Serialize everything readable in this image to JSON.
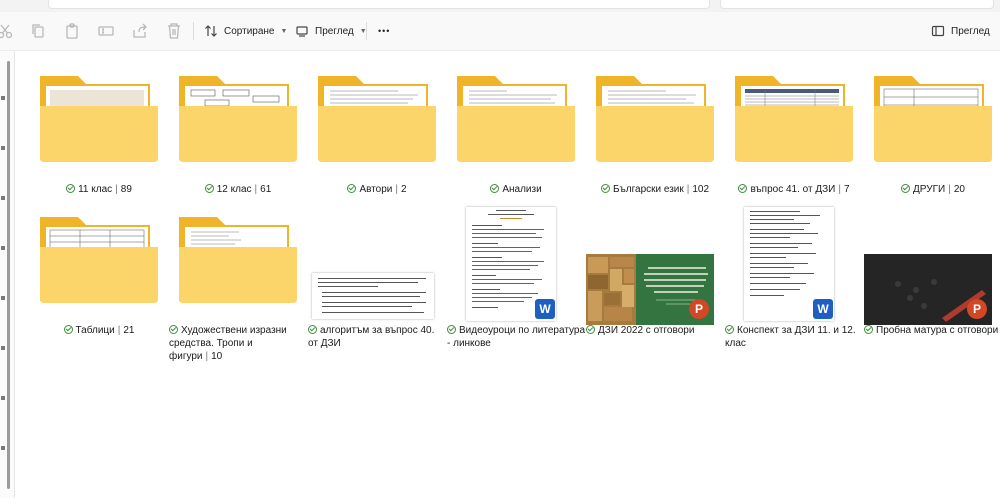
{
  "toolbar": {
    "sort_label": "Сортиране",
    "view_label": "Преглед",
    "more_label": "•••",
    "preview_label": "Преглед"
  },
  "items": [
    {
      "name": "11 клас",
      "count": "89",
      "type": "folder"
    },
    {
      "name": "12 клас",
      "count": "61",
      "type": "folder"
    },
    {
      "name": "Автори",
      "count": "2",
      "type": "folder"
    },
    {
      "name": "Анализи",
      "count": "",
      "type": "folder"
    },
    {
      "name": "Български език",
      "count": "102",
      "type": "folder"
    },
    {
      "name": "въпрос 41. от ДЗИ",
      "count": "7",
      "type": "folder"
    },
    {
      "name": "ДРУГИ",
      "count": "20",
      "type": "folder"
    },
    {
      "name": "Таблици",
      "count": "21",
      "type": "folder"
    },
    {
      "name": "Художествени изразни средства. Тропи и фигури",
      "count": "10",
      "type": "folder"
    },
    {
      "name": "алгоритъм за въпрос 40. от ДЗИ",
      "count": "",
      "type": "word"
    },
    {
      "name": "Видеоуроци по литература - линкове",
      "count": "",
      "type": "word"
    },
    {
      "name": "ДЗИ 2022 с отговори",
      "count": "",
      "type": "powerpoint"
    },
    {
      "name": "Конспект за ДЗИ 11. и 12. клас",
      "count": "",
      "type": "word"
    },
    {
      "name": "Пробна матура с отговори",
      "count": "",
      "type": "powerpoint"
    }
  ],
  "colors": {
    "folder_back": "#f0b429",
    "folder_front": "#fcd56a",
    "word_badge": "#1e5fc1",
    "powerpoint_badge": "#d24726",
    "synced_green": "#3c8f3c"
  },
  "badges": {
    "word": "W",
    "powerpoint": "P"
  }
}
